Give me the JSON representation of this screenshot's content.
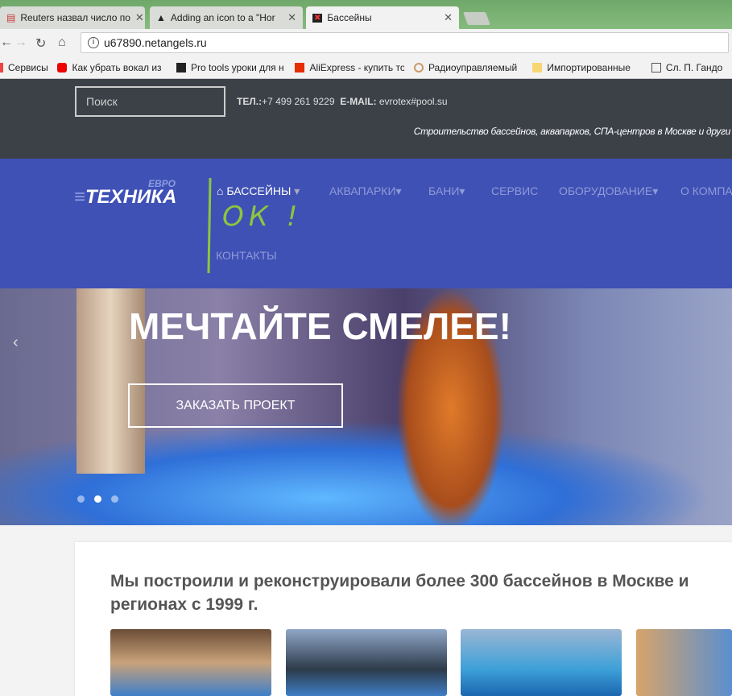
{
  "browser": {
    "tabs": [
      {
        "title": "Reuters назвал число по"
      },
      {
        "title": "Adding an icon to a \"Hor"
      },
      {
        "title": "Бассейны",
        "active": true
      }
    ],
    "url": "u67890.netangels.ru",
    "bookmarks": [
      "Сервисы",
      "Как убрать вокал из",
      "Pro tools уроки для н",
      "AliExpress - купить то",
      "Радиоуправляемый",
      "Импортированные",
      "Сл. П. Гандо"
    ]
  },
  "header": {
    "search_placeholder": "Поиск",
    "tel_label": "ТЕЛ.:",
    "tel": "+7 499 261 9229",
    "email_label": "E-MAIL:",
    "email": "evrotex#pool.su",
    "slogan": "Строительство бассейнов, аквапарков, СПА-центров в Москве и други"
  },
  "logo": {
    "evro": "ЕВРО",
    "main": "ТЕХНИКА"
  },
  "menu": [
    "БАССЕЙНЫ",
    "АКВАПАРКИ",
    "БАНИ",
    "СЕРВИС",
    "ОБОРУДОВАНИЕ",
    "О КОМПА",
    "КОНТАКТЫ"
  ],
  "annotation": "ОК !",
  "hero": {
    "title": "МЕЧТАЙТЕ СМЕЛЕЕ!",
    "cta": "ЗАКАЗАТЬ ПРОЕКТ",
    "slides": 3,
    "active_slide": 2
  },
  "intro": {
    "heading": "Мы построили и реконструировали более 300 бассейнов в Москве и регионах с 1999 г."
  },
  "colors": {
    "header": "#3c4148",
    "nav": "#3f51b5",
    "annotation": "#8cc63f"
  }
}
